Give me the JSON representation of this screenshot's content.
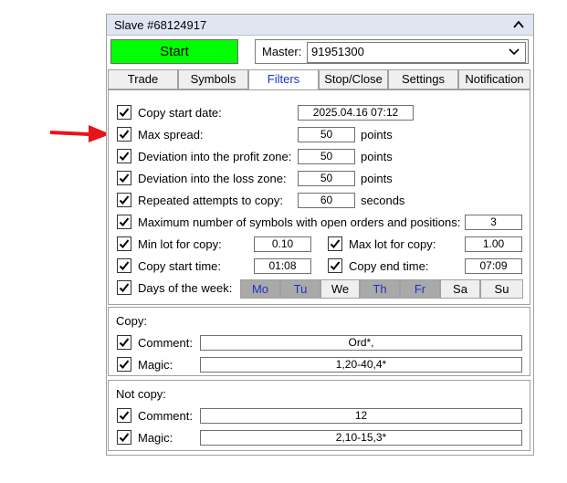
{
  "window": {
    "title": "Slave #68124917"
  },
  "start_button": {
    "label": "Start",
    "color": "#00ff00"
  },
  "master": {
    "label": "Master:",
    "value": "91951300"
  },
  "tabs": [
    {
      "label": "Trade"
    },
    {
      "label": "Symbols"
    },
    {
      "label": "Filters"
    },
    {
      "label": "Stop/Close"
    },
    {
      "label": "Settings"
    },
    {
      "label": "Notification"
    }
  ],
  "active_tab": "Filters",
  "filters": {
    "copy_start_date": {
      "label": "Copy start date:",
      "value": "2025.04.16 07:12"
    },
    "max_spread": {
      "label": "Max spread:",
      "value": "50",
      "unit": "points"
    },
    "dev_profit": {
      "label": "Deviation into the profit zone:",
      "value": "50",
      "unit": "points"
    },
    "dev_loss": {
      "label": "Deviation into the loss zone:",
      "value": "50",
      "unit": "points"
    },
    "repeated": {
      "label": "Repeated attempts to copy:",
      "value": "60",
      "unit": "seconds"
    },
    "max_symbols": {
      "label": "Maximum number of symbols with open orders and positions:",
      "value": "3"
    },
    "min_lot": {
      "label": "Min lot for copy:",
      "value": "0.10"
    },
    "max_lot": {
      "label": "Max lot for copy:",
      "value": "1.00"
    },
    "copy_start_time": {
      "label": "Copy start time:",
      "value": "01:08"
    },
    "copy_end_time": {
      "label": "Copy end time:",
      "value": "07:09"
    },
    "days_label": "Days of the week:",
    "days": [
      {
        "label": "Mo",
        "selected": true
      },
      {
        "label": "Tu",
        "selected": true
      },
      {
        "label": "We",
        "selected": false
      },
      {
        "label": "Th",
        "selected": true
      },
      {
        "label": "Fr",
        "selected": true
      },
      {
        "label": "Sa",
        "selected": false
      },
      {
        "label": "Su",
        "selected": false
      }
    ]
  },
  "copy": {
    "header": "Copy:",
    "comment": {
      "label": "Comment:",
      "value": "Ord*,"
    },
    "magic": {
      "label": "Magic:",
      "value": "1,20-40,4*"
    }
  },
  "not_copy": {
    "header": "Not copy:",
    "comment": {
      "label": "Comment:",
      "value": "12"
    },
    "magic": {
      "label": "Magic:",
      "value": "2,10-15,3*"
    }
  },
  "colors": {
    "arrow": "#e8141c",
    "selected_day_text": "#1a33c8",
    "selected_day_bg": "#a9a9a9",
    "title_bar": "#dfe6f2"
  }
}
